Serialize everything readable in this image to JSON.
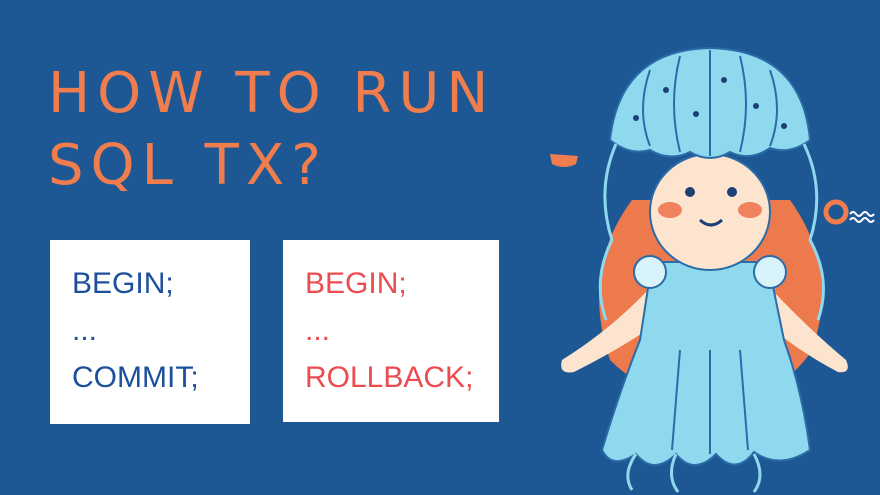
{
  "title": {
    "line1": "HOW TO RUN",
    "line2": "SQL TX?"
  },
  "cards": [
    {
      "lines": [
        "BEGIN;",
        "...",
        "COMMIT;"
      ]
    },
    {
      "lines": [
        "BEGIN;",
        "...",
        "ROLLBACK;"
      ]
    }
  ],
  "colors": {
    "background": "#1d5895",
    "title": "#ef7d4d",
    "commit_text": "#1c4f9c",
    "rollback_text": "#ec4c50",
    "jellyfish": "#8fd9ee"
  },
  "illustration": {
    "name": "jellyfish-girl",
    "icons": [
      "jellyfish-hat-icon",
      "bubble-icon"
    ]
  }
}
